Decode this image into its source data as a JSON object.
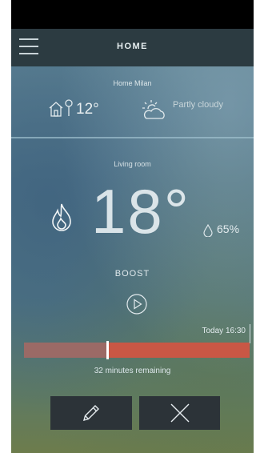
{
  "header": {
    "title": "HOME",
    "menu_icon": "hamburger-menu-icon"
  },
  "weather": {
    "location": "Home Milan",
    "outdoor_temperature": "12°",
    "condition": "Partly cloudy",
    "icons": [
      "home-thermometer-icon",
      "partly-cloudy-icon"
    ]
  },
  "room": {
    "name": "Living room",
    "temperature": "18°",
    "humidity": "65%",
    "heating_icon": "flame-icon",
    "humidity_icon": "water-drop-icon"
  },
  "boost": {
    "label": "BOOST",
    "play_icon": "play-circle-icon",
    "end_time": "Today 16:30",
    "remaining": "32 minutes remaining",
    "progress_fraction": 0.37
  },
  "actions": {
    "edit_icon": "pencil-icon",
    "cancel_icon": "close-icon"
  },
  "colors": {
    "topbar": "#2c3b41",
    "progress_remaining": "#c95745",
    "progress_elapsed": "#9b6a66",
    "button_bg": "#2c3338"
  }
}
